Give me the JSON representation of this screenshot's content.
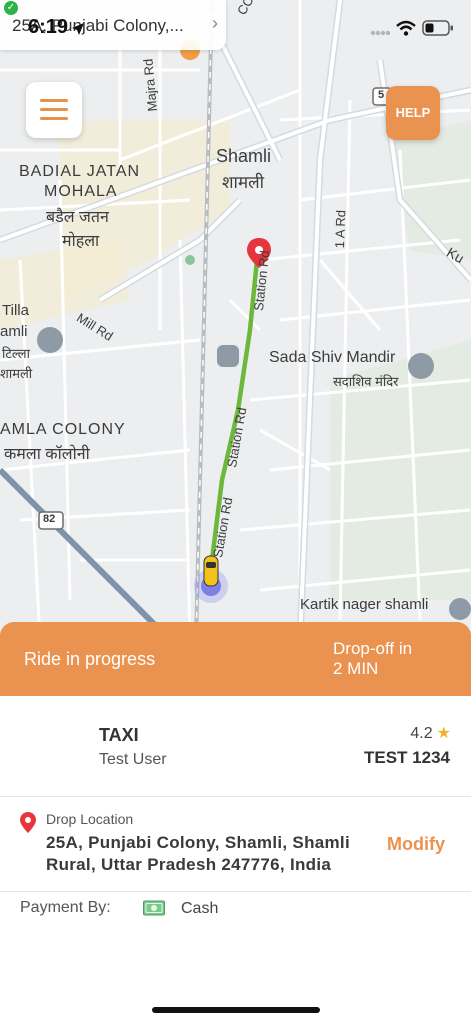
{
  "status_bar": {
    "time": "6:19",
    "back_app_text": "25A, Punjabi Colony,..."
  },
  "map": {
    "labels": {
      "shamli": "Shamli",
      "shamli_hindi": "शामली",
      "badial_1": "BADIAL JATAN",
      "badial_2": "MOHALA",
      "badial_hi_1": "बडैल जतन",
      "badial_hi_2": "मोहला",
      "tilla": "Tilla",
      "shamli_cut": "amli",
      "tilla_hi": "टिल्ला",
      "shamli_cut_hi": "शामली",
      "kamla_colony": "AMLA COLONY",
      "kamla_hi": "कमला कॉलोनी",
      "sada_shiv": "Sada Shiv Mandir",
      "sada_shiv_hi": "सदाशिव मंदिर",
      "kartik": "Kartik nager shamli",
      "ccs_rd": "CCS Rd",
      "majra_rd": "Majra Rd",
      "mill_rd": "Mill Rd",
      "station_rd_1": "Station Rd",
      "station_rd_2": "Station Rd",
      "station_rd_3": "Station Rd",
      "one_a_rd": "1 A Rd",
      "hwy_82": "82",
      "hwy_5": "5",
      "ku": "Ku"
    }
  },
  "buttons": {
    "help": "HELP"
  },
  "ride": {
    "status": "Ride in progress",
    "eta_line1": "Drop-off in",
    "eta_line2": "2 MIN"
  },
  "driver": {
    "vehicle_type": "TAXI",
    "name": "Test User",
    "rating": "4.2",
    "star": "★",
    "plate": "TEST 1234"
  },
  "drop": {
    "label": "Drop Location",
    "address": "25A, Punjabi Colony, Shamli, Shamli Rural, Uttar Pradesh 247776, India",
    "modify": "Modify"
  },
  "payment": {
    "label": "Payment By:",
    "method": "Cash"
  },
  "colors": {
    "accent": "#ea924f",
    "route": "#6bb83a",
    "pin": "#e8343c"
  }
}
